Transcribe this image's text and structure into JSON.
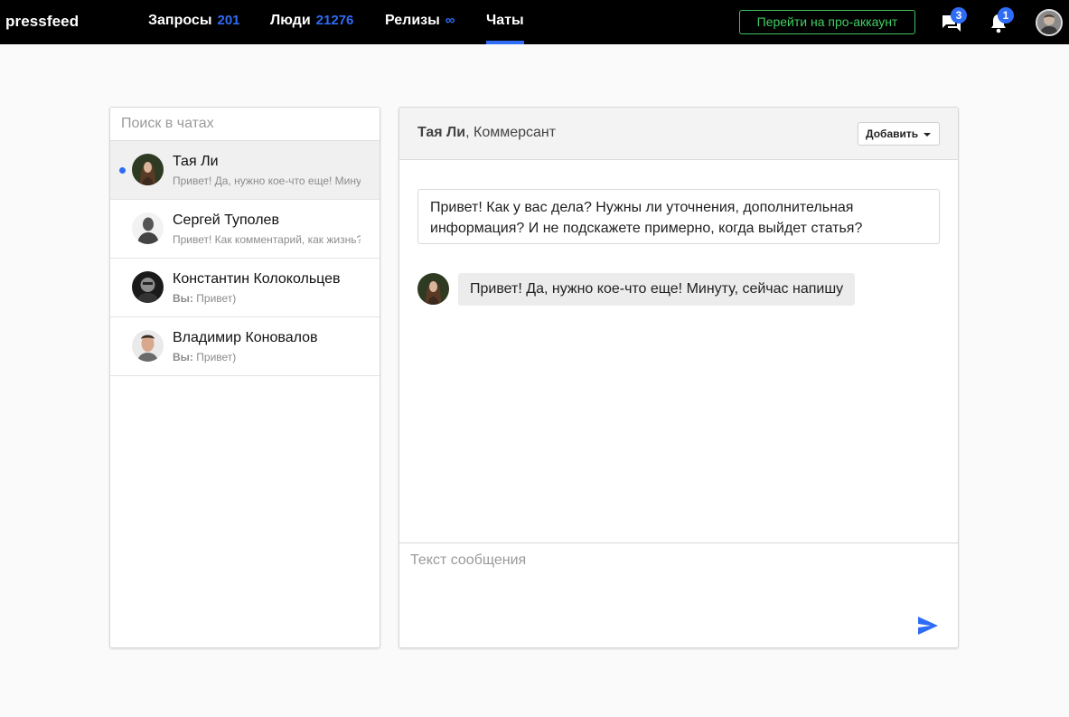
{
  "brand": {
    "name": "pressfeed"
  },
  "nav": {
    "requests": {
      "label": "Запросы",
      "count": "201"
    },
    "people": {
      "label": "Люди",
      "count": "21276"
    },
    "releases": {
      "label": "Релизы",
      "count": "∞"
    },
    "chats": {
      "label": "Чаты"
    }
  },
  "header_actions": {
    "pro_label": "Перейти на про-аккаунт",
    "messages_badge": "3",
    "notifications_badge": "1",
    "icons": [
      "chat-bubbles-icon",
      "bell-icon",
      "user-avatar"
    ]
  },
  "colors": {
    "accent": "#2f6cf5",
    "pro_green": "#3fcf63",
    "topbar": "#000000"
  },
  "chat_list": {
    "search_placeholder": "Поиск в чатах",
    "items": [
      {
        "name": "Тая Ли",
        "prefix": "",
        "preview": "Привет! Да, нужно кое-что еще! Минуту, сейчас напишу",
        "unread": true,
        "active": true
      },
      {
        "name": "Сергей Туполев",
        "prefix": "",
        "preview": "Привет! Как комментарий, как жизнь?",
        "unread": false,
        "active": false
      },
      {
        "name": "Константин Колокольцев",
        "prefix": "Вы:",
        "preview": "Привет)",
        "unread": false,
        "active": false
      },
      {
        "name": "Владимир Коновалов",
        "prefix": "Вы:",
        "preview": "Привет)",
        "unread": false,
        "active": false
      }
    ]
  },
  "conversation": {
    "contact_name": "Тая Ли",
    "contact_org": ", Коммерсант",
    "add_label": "Добавить",
    "messages": [
      {
        "direction": "out",
        "text": "Привет! Как у вас дела? Нужны ли уточнения, дополнительная информация? И не подскажете примерно, когда выйдет статья?"
      },
      {
        "direction": "in",
        "text": "Привет! Да, нужно кое-что еще! Минуту, сейчас напишу"
      }
    ],
    "composer_placeholder": "Текст сообщения"
  }
}
